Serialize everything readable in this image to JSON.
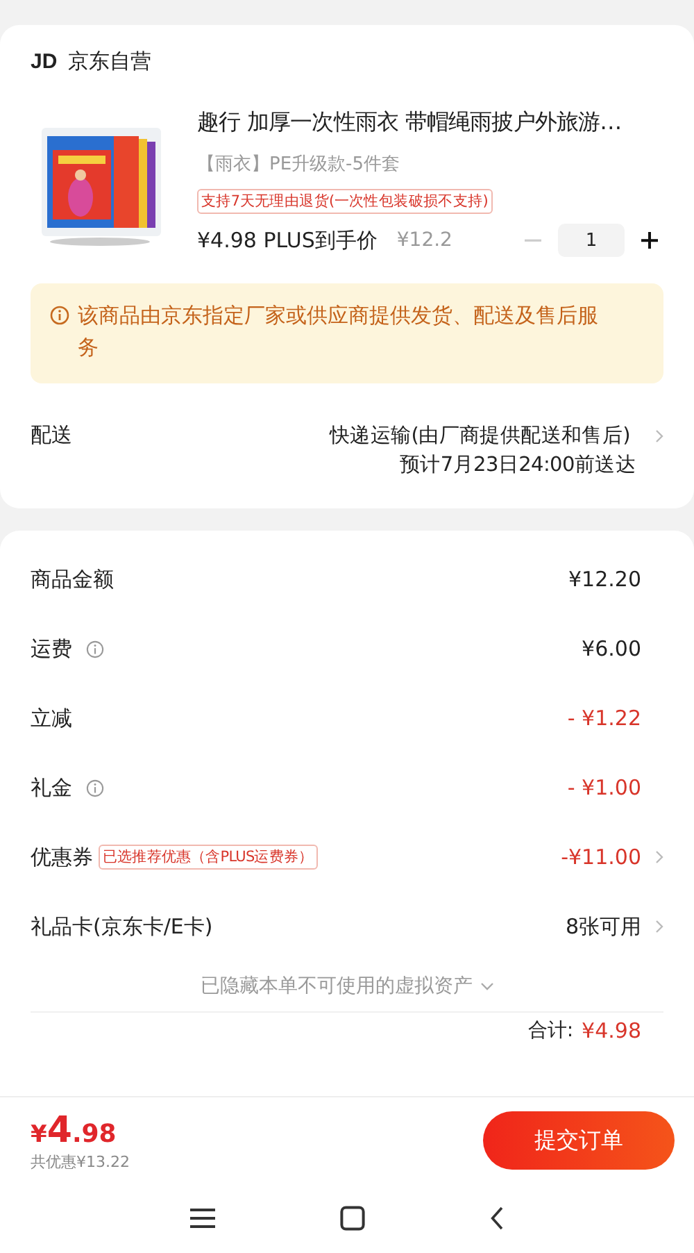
{
  "store": {
    "logo": "JD",
    "name": "京东自营"
  },
  "product": {
    "kind": "picture",
    "title": "趣行 加厚一次性雨衣 带帽绳雨披户外旅游…",
    "variant": "【雨衣】PE升级款-5件套",
    "return_tag": "支持7天无理由退货(一次性包装破损不支持)",
    "price": "¥4.98 PLUS到手价",
    "original_price": "¥12.2",
    "quantity": "1",
    "minus_disabled": true
  },
  "notice": "该商品由京东指定厂家或供应商提供发货、配送及售后服务",
  "delivery": {
    "label": "配送",
    "method": "快递运输(由厂商提供配送和售后)",
    "eta": "预计7月23日24:00前送达"
  },
  "summary": [
    {
      "label": "商品金额",
      "info": false,
      "kind": "plain",
      "value": "¥12.20",
      "arrow": false
    },
    {
      "label": "运费",
      "info": true,
      "kind": "plain",
      "value": "¥6.00",
      "arrow": false
    },
    {
      "label": "立减",
      "info": false,
      "kind": "discount",
      "value": "- ¥1.22",
      "arrow": false
    },
    {
      "label": "礼金",
      "info": true,
      "kind": "discount",
      "value": "- ¥1.00",
      "arrow": false
    },
    {
      "label": "优惠券",
      "info": false,
      "kind": "discount",
      "tag": "已选推荐优惠（含PLUS运费券）",
      "value": "-¥11.00",
      "arrow": true
    },
    {
      "label": "礼品卡(京东卡/E卡)",
      "info": false,
      "kind": "plain",
      "value": "8张可用",
      "arrow": true
    }
  ],
  "hidden_assets": "已隐藏本单不可使用的虚拟资产",
  "total": {
    "label": "合计:",
    "value": "¥4.98"
  },
  "bottom_bar": {
    "currency": "¥",
    "integer": "4",
    "decimal": ".98",
    "savings": "共优惠¥13.22",
    "submit": "提交订单"
  }
}
